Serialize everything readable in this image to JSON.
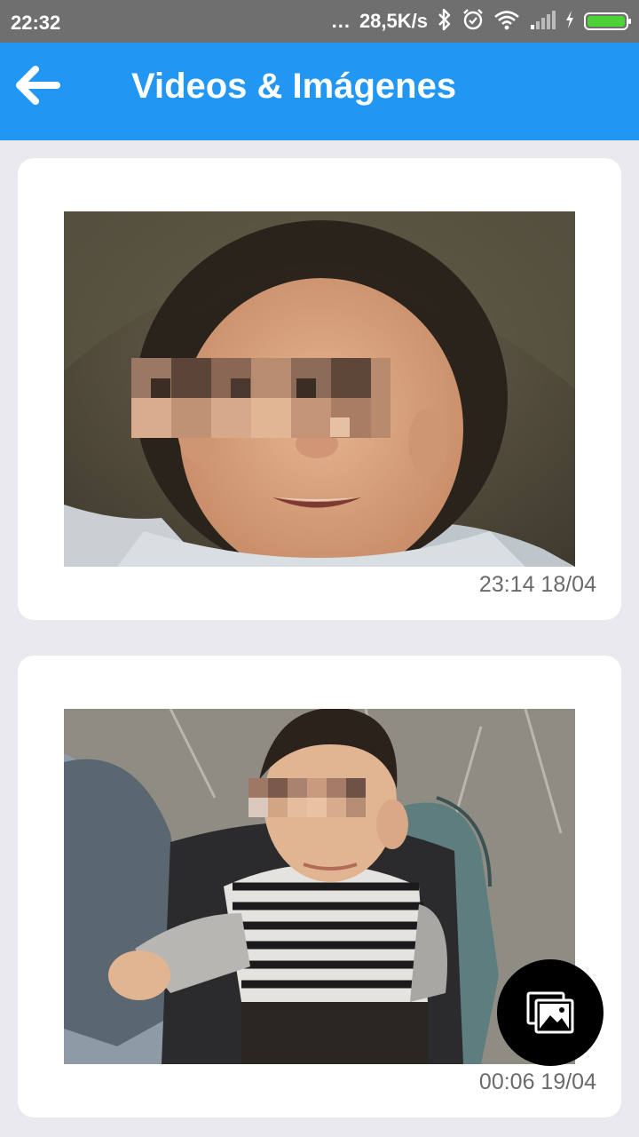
{
  "status_bar": {
    "time": "22:32",
    "dots": "...",
    "speed": "28,5K/s",
    "icons": [
      "bluetooth-icon",
      "alarm-icon",
      "wifi-icon",
      "signal-icon",
      "charging-icon",
      "battery-icon"
    ]
  },
  "app_bar": {
    "title": "Videos & Imágenes",
    "back_icon": "arrow-left-icon"
  },
  "media_items": [
    {
      "timestamp": "23:14 18/04"
    },
    {
      "timestamp": "00:06 19/04"
    }
  ],
  "fab": {
    "icon": "gallery-icon"
  },
  "colors": {
    "app_bar": "#2196f3",
    "status_bar": "#6f6f6f",
    "background": "#e9e9ee",
    "battery": "#4cd137",
    "fab": "#000000"
  }
}
